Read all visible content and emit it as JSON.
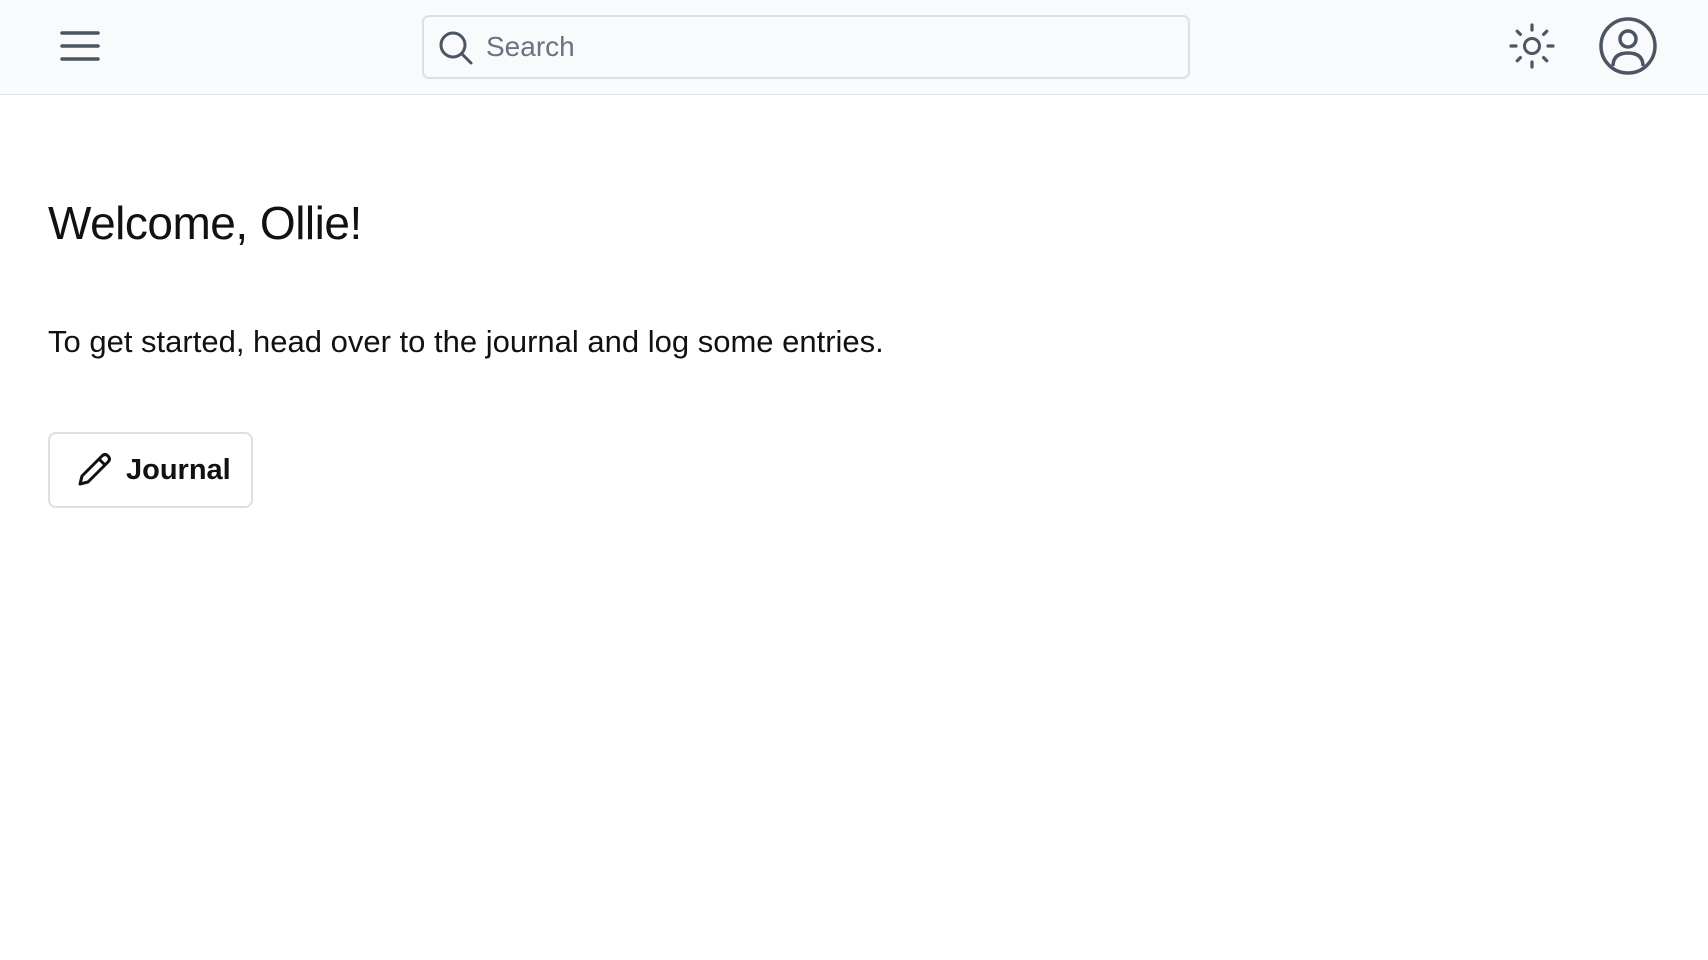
{
  "header": {
    "menu_icon": "hamburger-menu-icon",
    "search": {
      "placeholder": "Search",
      "value": "",
      "icon": "search-icon"
    },
    "theme_icon": "sun-icon",
    "account_icon": "user-circle-icon"
  },
  "main": {
    "title": "Welcome, Ollie!",
    "intro": "To get started, head over to the journal and log some entries.",
    "journal_button": {
      "label": "Journal",
      "icon": "pencil-icon"
    }
  },
  "colors": {
    "header_bg": "#f9fafb",
    "header_border": "#e2e4e8",
    "icon_gray": "#4b5563",
    "text": "#111111",
    "placeholder": "#6b7280",
    "button_border": "#dcdfe4"
  }
}
